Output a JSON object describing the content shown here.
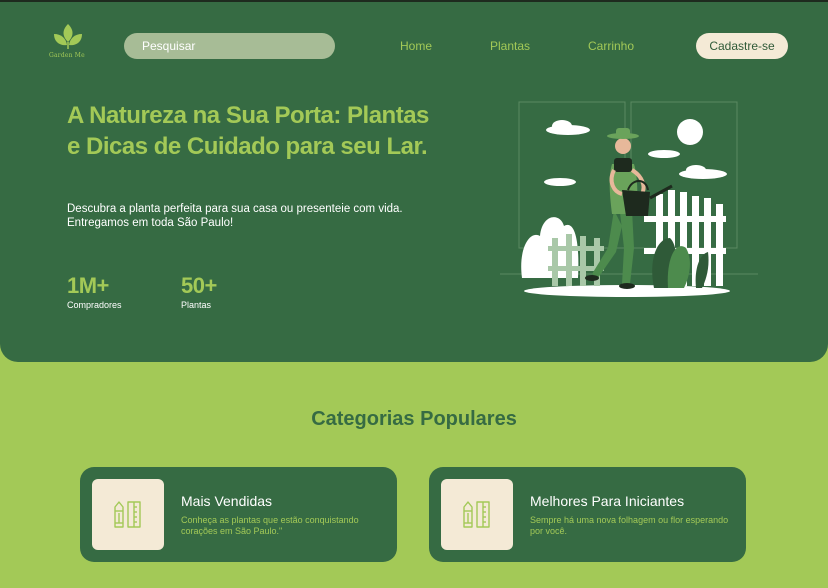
{
  "header": {
    "logo_text": "Garden Me",
    "search_placeholder": "Pesquisar",
    "nav": [
      {
        "label": "Home"
      },
      {
        "label": "Plantas"
      },
      {
        "label": "Carrinho"
      }
    ],
    "signup_label": "Cadastre-se"
  },
  "hero": {
    "title": "A Natureza na Sua Porta: Plantas e Dicas de Cuidado para seu Lar.",
    "subtitle": "Descubra a planta perfeita para sua casa ou presenteie com vida. Entregamos em toda São Paulo!",
    "stats": [
      {
        "value": "1M+",
        "label": "Compradores"
      },
      {
        "value": "50+",
        "label": "Plantas"
      }
    ]
  },
  "categories": {
    "title": "Categorias Populares",
    "cards": [
      {
        "title": "Mais Vendidas",
        "description": "Conheça as plantas que estão conquistando corações em São Paulo.\"",
        "icon": "pencil-ruler-icon"
      },
      {
        "title": "Melhores Para Iniciantes",
        "description": "Sempre há uma nova folhagem ou flor esperando por você.",
        "icon": "pencil-ruler-icon"
      }
    ]
  },
  "colors": {
    "dark_green": "#366b43",
    "lime": "#a3c957",
    "cream": "#f4ead6"
  }
}
